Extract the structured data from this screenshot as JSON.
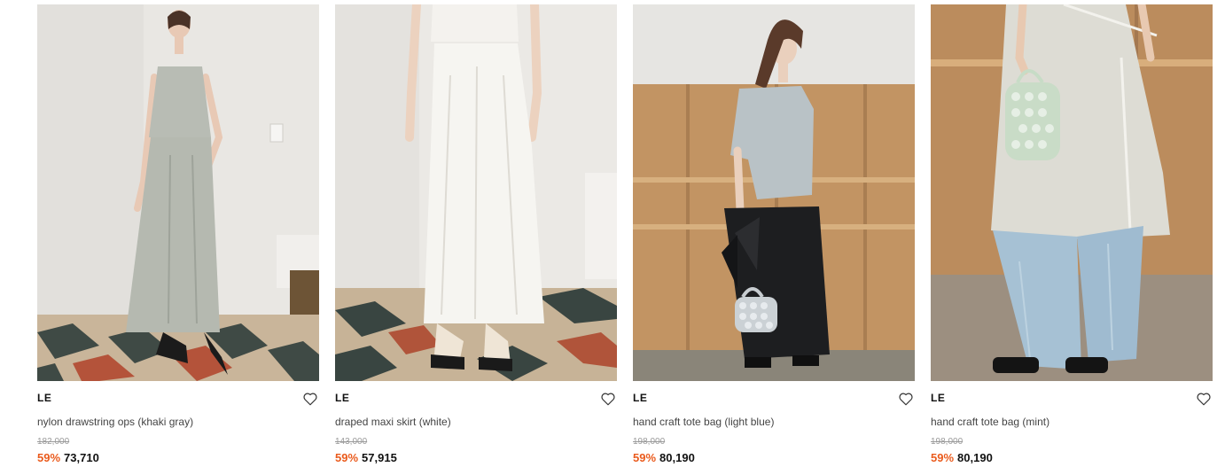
{
  "products": [
    {
      "brand": "LE",
      "name": "nylon drawstring ops (khaki gray)",
      "original_price": "182,000",
      "discount": "59%",
      "price": "73,710",
      "image_desc_icon": "product-photo"
    },
    {
      "brand": "LE",
      "name": "draped maxi skirt (white)",
      "original_price": "143,000",
      "discount": "59%",
      "price": "57,915",
      "image_desc_icon": "product-photo"
    },
    {
      "brand": "LE",
      "name": "hand craft tote bag (light blue)",
      "original_price": "198,000",
      "discount": "59%",
      "price": "80,190",
      "image_desc_icon": "product-photo"
    },
    {
      "brand": "LE",
      "name": "hand craft tote bag (mint)",
      "original_price": "198,000",
      "discount": "59%",
      "price": "80,190",
      "image_desc_icon": "product-photo"
    }
  ],
  "colors": {
    "discount": "#ea5b1d",
    "original_price": "#9a9a9a",
    "text": "#111111"
  },
  "icons": {
    "wishlist": "heart-outline-icon"
  }
}
